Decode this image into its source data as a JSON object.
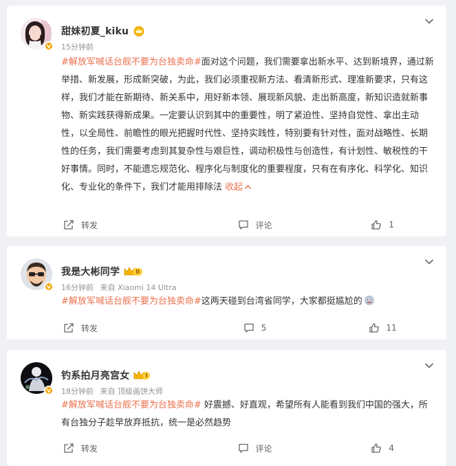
{
  "posts": [
    {
      "username": "甜妹初夏_kiku",
      "time": "15分钟前",
      "source": "",
      "hashtag": "#解放军喊话台舰不要为台独卖命#",
      "text": "面对这个问题，我们需要拿出新水平、达到新境界，通过新举措、新发展，形成新突破，为此，我们必须重视新方法、看清新形式、理准新要求，只有这样，我们才能在新期待、新关系中，用好新本领、展现新风貌、走出新高度，新知识造就新事物、新实践获得新成果。一定要认识到其中的重要性，明了紧迫性、坚持自觉性、拿出主动性，以全局性、前瞻性的眼光把握时代性、坚持实践性，特别要有针对性，面对战略性、长期性的任务，我们需要考虑到其复杂性与艰巨性，调动积极性与创造性，有计划性、敏税性的干好事情。同时，不能遗忘规范化、程序化与制度化的重要程度，只有在有序化、科学化、知识化、专业化的条件下，我们才能用排除法",
      "collapse": "收起",
      "actions": {
        "repost": "转发",
        "comment": "评论",
        "like": "1"
      }
    },
    {
      "username": "我是大彬同学",
      "level": "II",
      "time": "16分钟前",
      "source": "来自 Xiaomi 14 Ultra",
      "hashtag": "#解放军喊话台舰不要为台独卖命#",
      "text": "这两天碰到台湾省同学，大家都挺尴尬的",
      "actions": {
        "repost": "转发",
        "comment": "5",
        "like": "11"
      }
    },
    {
      "username": "钓系拍月亮宫女",
      "level": "I",
      "time": "18分钟前",
      "source": "来自 顶级画饼大师",
      "hashtag": "#解放军喊话台舰不要为台独卖命#",
      "text": " 好震撼、好直观，希望所有人能看到我们中国的强大，所有台独分子趁早放弃抵抗，统一是必然趋势",
      "actions": {
        "repost": "转发",
        "comment": "评论",
        "like": "4"
      }
    }
  ],
  "icons": {
    "repost": "repost-icon",
    "comment": "comment-icon",
    "like": "thumbs-up-icon",
    "more": "chevron-down-icon",
    "verified": "verified-badge-icon",
    "crown": "crown-icon"
  },
  "colors": {
    "hashtag": "#eb7350",
    "verified": "#f7a600",
    "crown": "#f7b500",
    "background": "#f0f1f4"
  }
}
